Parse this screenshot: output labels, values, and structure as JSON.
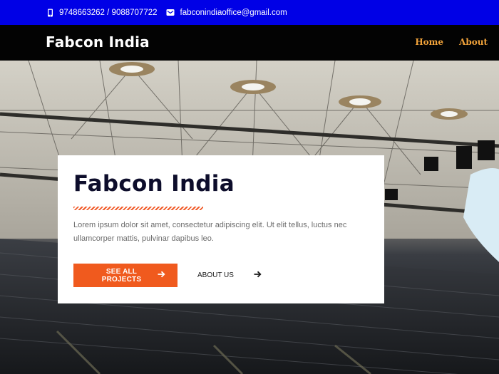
{
  "topbar": {
    "phone_icon": "phone-icon",
    "phone": "9748663262 / 9088707722",
    "email_icon": "envelope-icon",
    "email": "fabconindiaoffice@gmail.com",
    "background": "#0000e6"
  },
  "navbar": {
    "brand": "Fabcon India",
    "links": [
      {
        "label": "Home"
      },
      {
        "label": "About"
      }
    ],
    "link_color": "#f0a23a"
  },
  "hero": {
    "title": "Fabcon India",
    "description": "Lorem ipsum dolor sit amet, consectetur adipiscing elit. Ut elit tellus, luctus nec ullamcorper mattis, pulvinar dapibus leo.",
    "primary_button": {
      "label": "SEE ALL PROJECTS",
      "icon": "arrow-right-icon"
    },
    "secondary_button": {
      "label": "ABOUT US",
      "icon": "arrow-right-icon"
    },
    "accent": "#f05a1e"
  }
}
